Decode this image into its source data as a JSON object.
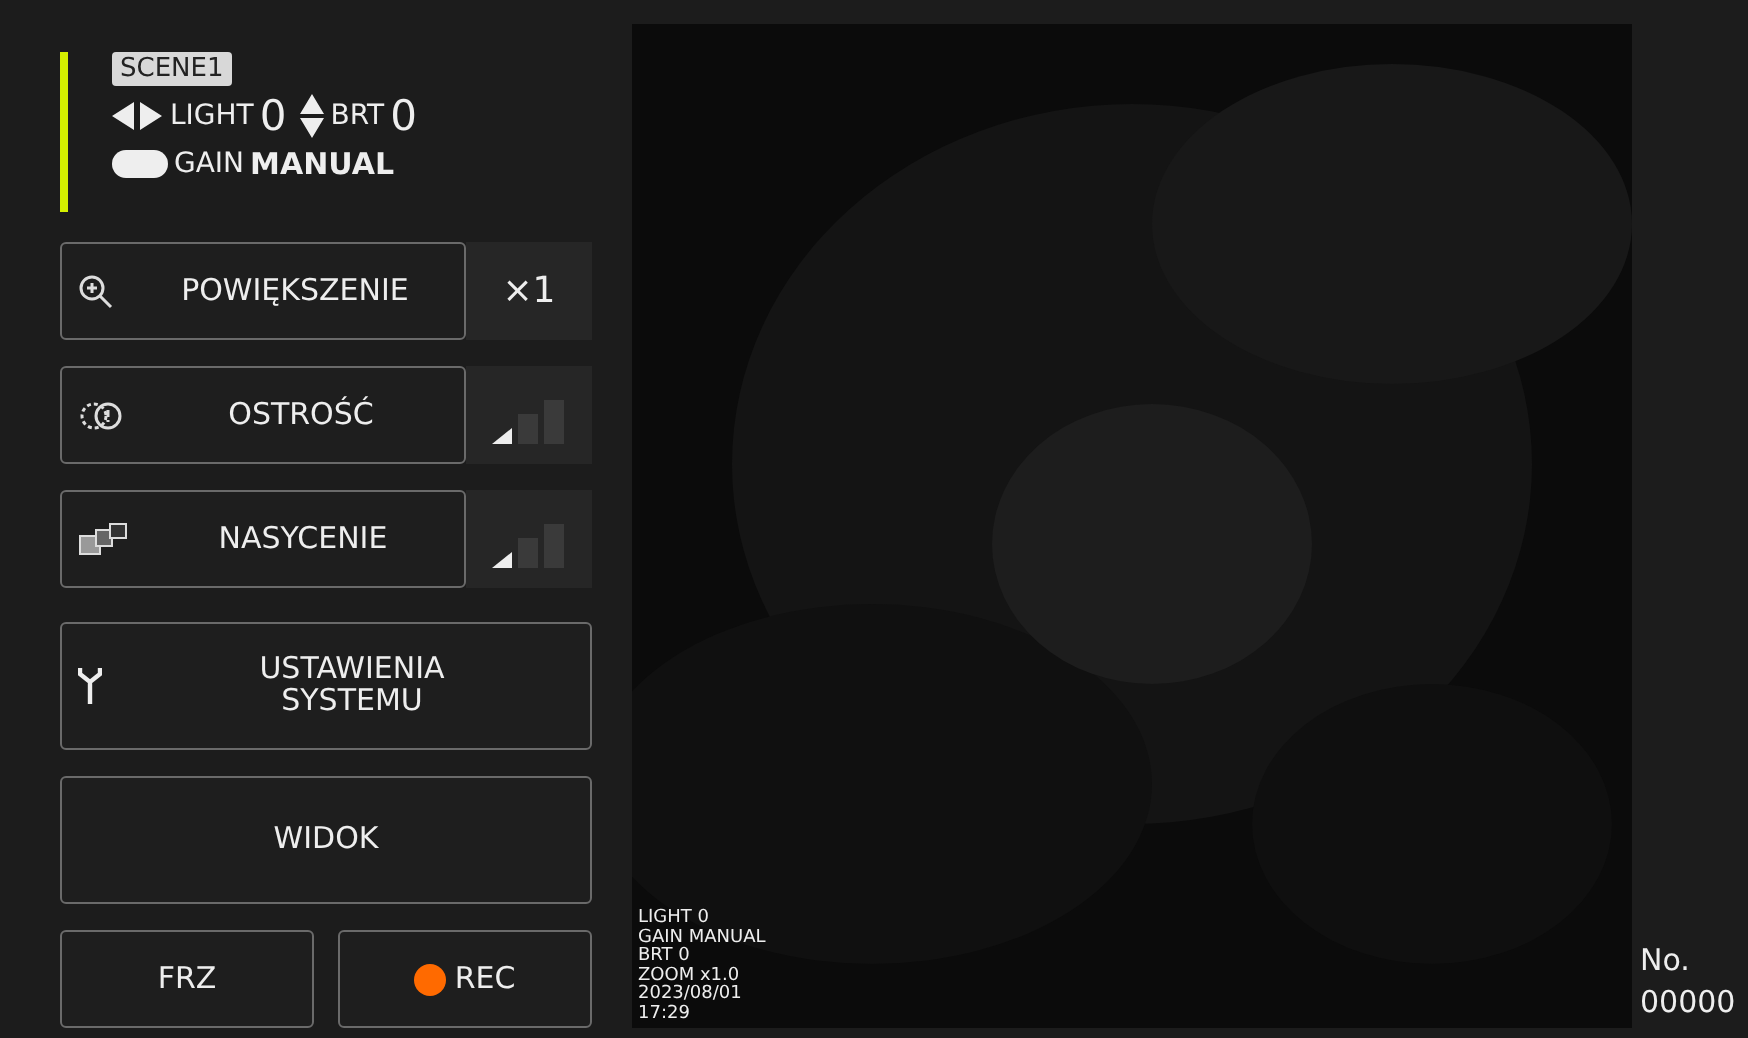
{
  "status": {
    "scene": "SCENE1",
    "light_label": "LIGHT",
    "light_value": "0",
    "brt_label": "BRT",
    "brt_value": "0",
    "gain_label": "GAIN",
    "gain_value": "MANUAL"
  },
  "controls": [
    {
      "kind": "value",
      "label": "POWIĘKSZENIE",
      "value": "×1"
    },
    {
      "kind": "meter",
      "label": "OSTROŚĆ"
    },
    {
      "kind": "meter",
      "label": "NASYCENIE"
    }
  ],
  "settings_button": "USTAWIENIA SYSTEMU",
  "view_button": "WIDOK",
  "freeze_button": "FRZ",
  "record_button": "REC",
  "overlay": [
    "LIGHT 0",
    "GAIN MANUAL",
    "BRT 0",
    "ZOOM x1.0",
    "2023/08/01",
    "17:29"
  ],
  "counter": {
    "label": "No.",
    "value": "00000"
  }
}
